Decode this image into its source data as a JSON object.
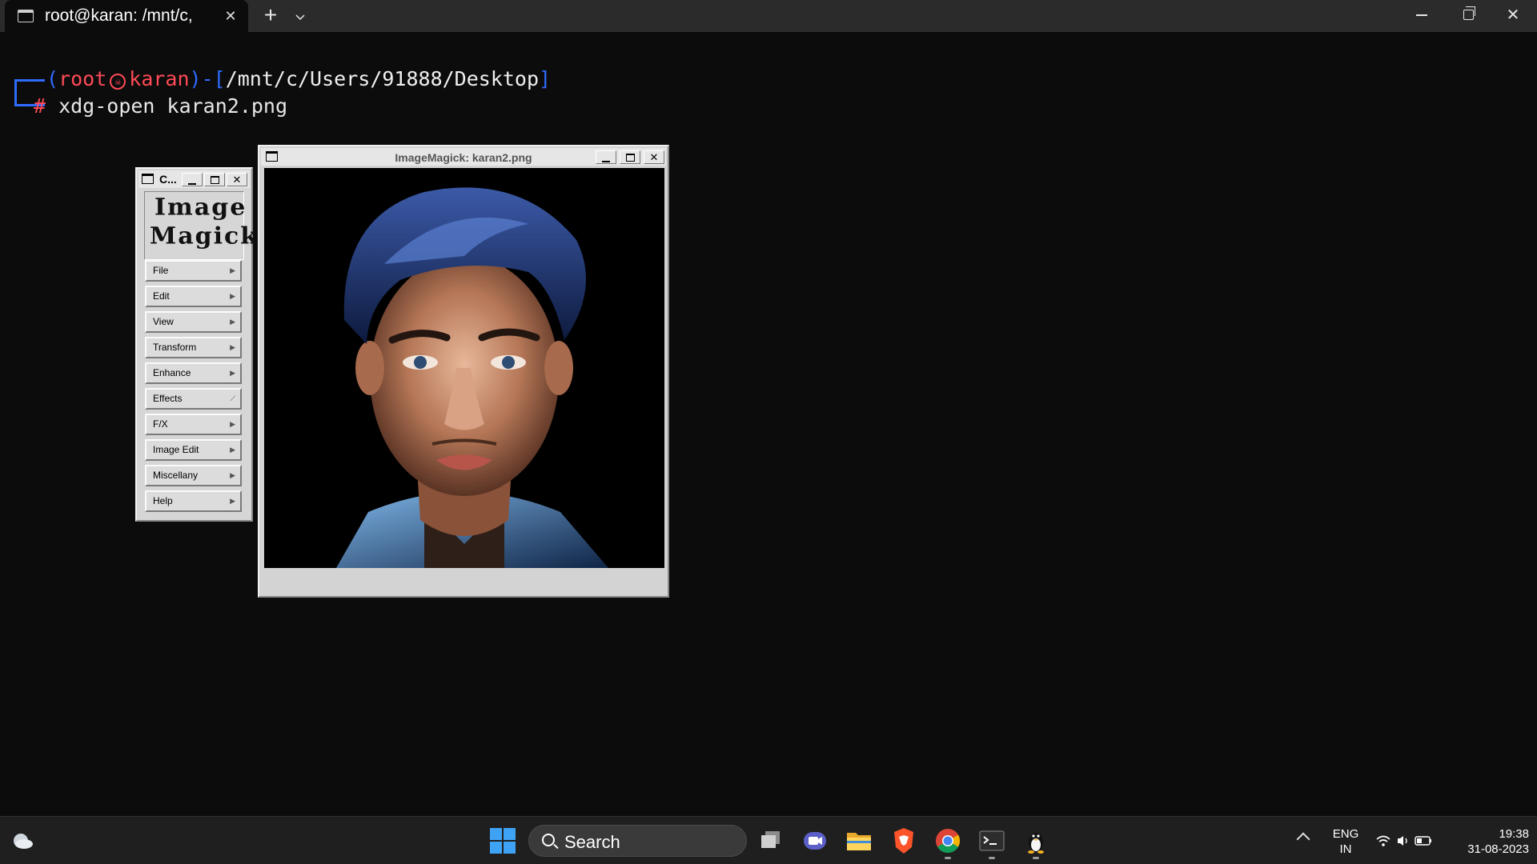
{
  "terminal_window": {
    "tab_title": "root@karan: /mnt/c,",
    "tab_close": "✕",
    "new_tab": "+",
    "dropdown": "⌄",
    "close_glyph": "✕"
  },
  "terminal": {
    "paren_open": "(",
    "user": "root",
    "host": "karan",
    "paren_close": ")-[",
    "path": "/mnt/c/Users/91888/Desktop",
    "bracket_close": "]",
    "prompt_symbol": "#",
    "command": "xdg-open karan2.png"
  },
  "imagemagick_commands": {
    "title": "C...",
    "logo_line1": "Image",
    "logo_line2": "Magick",
    "menu": [
      {
        "label": "File"
      },
      {
        "label": "Edit"
      },
      {
        "label": "View"
      },
      {
        "label": "Transform"
      },
      {
        "label": "Enhance"
      },
      {
        "label": "Effects"
      },
      {
        "label": "F/X"
      },
      {
        "label": "Image Edit"
      },
      {
        "label": "Miscellany"
      },
      {
        "label": "Help"
      }
    ]
  },
  "image_window": {
    "title": "ImageMagick: karan2.png"
  },
  "taskbar": {
    "search_label": "Search",
    "language_line1": "ENG",
    "language_line2": "IN",
    "time": "19:38",
    "date": "31-08-2023",
    "apps": [
      "task-view",
      "teams-chat",
      "file-explorer",
      "brave-browser",
      "chrome-browser",
      "terminal",
      "linux-penguin"
    ]
  },
  "colors": {
    "terminal_bg": "#0c0c0c",
    "prompt_blue": "#2f6bff",
    "prompt_red": "#ff4a57",
    "taskbar_bg": "#1f1f1f",
    "motif_gray": "#d6d6d6"
  }
}
